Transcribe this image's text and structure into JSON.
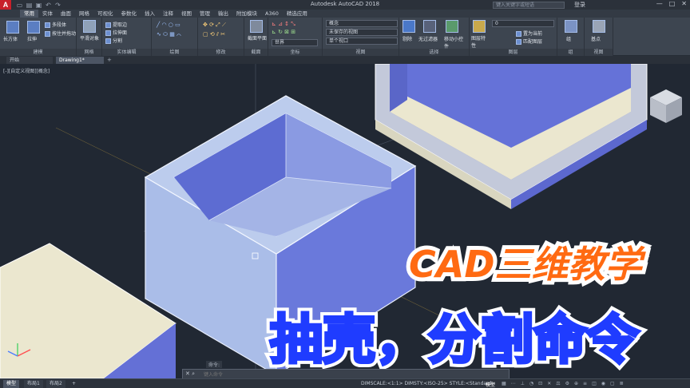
{
  "app": {
    "title": "Autodesk AutoCAD 2018",
    "logo": "A"
  },
  "titlebar": {
    "search_placeholder": "键入关键字或短语",
    "login": "登录",
    "qat_icons": [
      "new-icon",
      "open-icon",
      "save-icon",
      "undo-icon",
      "redo-icon"
    ]
  },
  "menu": {
    "tabs": [
      "常用",
      "实体",
      "曲面",
      "网格",
      "可视化",
      "参数化",
      "插入",
      "注释",
      "视图",
      "管理",
      "输出",
      "附加模块",
      "A360",
      "精选应用"
    ],
    "active": "常用"
  },
  "ribbon": {
    "panels": [
      {
        "title": "建模",
        "tools": [
          "长方体",
          "拉伸",
          "多段体",
          "按住并拖动"
        ]
      },
      {
        "title": "网格",
        "tools": [
          "平滑对象"
        ]
      },
      {
        "title": "实体编辑",
        "tools": [
          "提取边",
          "拉伸面",
          "分割"
        ]
      },
      {
        "title": "绘图",
        "tools": []
      },
      {
        "title": "修改",
        "tools": []
      },
      {
        "title": "截面",
        "tools": [
          "截面平面"
        ]
      },
      {
        "title": "坐标",
        "tools": [
          "世界"
        ]
      },
      {
        "title": "视图",
        "tools": [
          "概念",
          "未保存的视图",
          "单个视口"
        ]
      },
      {
        "title": "选择",
        "tools": [
          "剔除",
          "无过滤器",
          "移动小控件"
        ]
      },
      {
        "title": "图层",
        "tools": [
          "图层特性",
          "置为当前",
          "匹配图层"
        ]
      },
      {
        "title": "组",
        "tools": [
          "组"
        ]
      },
      {
        "title": "视图",
        "tools": [
          "基点"
        ]
      }
    ],
    "combos": {
      "visual_style": "概念",
      "named_view": "未保存的视图",
      "viewport": "单个视口",
      "ucs": "世界",
      "layer": "0"
    }
  },
  "doc_tabs": {
    "start": "开始",
    "drawing": "Drawing1*"
  },
  "viewport_label": "[-][自定义视图][概念]",
  "overlay": {
    "line1": "CAD三维教学",
    "line2": "抽壳，分割命令"
  },
  "command": {
    "tag": "命令:",
    "placeholder": "键入命令"
  },
  "status": {
    "layout_tabs": [
      "模型",
      "布局1",
      "布局2"
    ],
    "active_layout": "模型",
    "dimscale_text": "DIMSCALE:<1:1> DIMSTY:<ISO-25> STYLE:<Standard>",
    "mode": "模型"
  },
  "colors": {
    "canvas_bg": "#212833",
    "solid_top": "#ece9d4",
    "solid_side": "#6470d6",
    "shell_light": "#b4c6ec",
    "title_orange": "#ff6a12",
    "title_blue": "#1f3cff"
  }
}
